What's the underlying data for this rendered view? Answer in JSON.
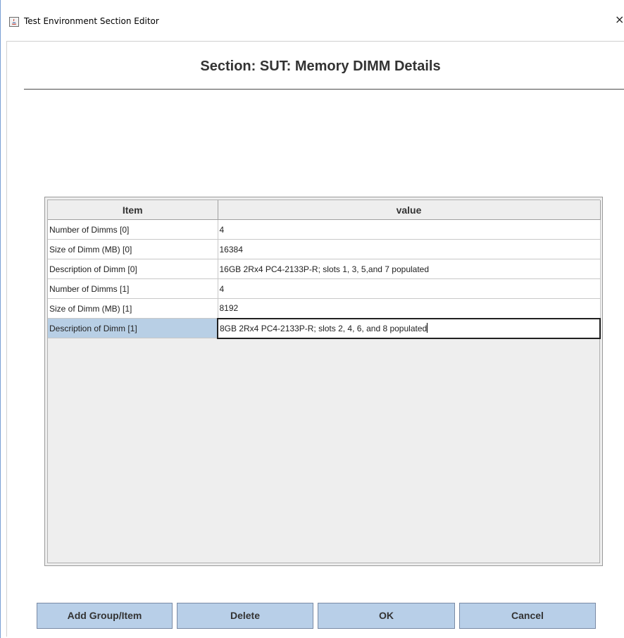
{
  "window": {
    "title": "Test Environment Section Editor",
    "close_glyph": "×",
    "icon": "java-app-icon"
  },
  "header": {
    "title": "Section: SUT: Memory DIMM Details"
  },
  "table": {
    "columns": [
      "Item",
      "value"
    ],
    "rows": [
      {
        "item": "Number of Dimms [0]",
        "value": "4"
      },
      {
        "item": "Size of Dimm (MB) [0]",
        "value": "16384"
      },
      {
        "item": "Description of Dimm [0]",
        "value": "16GB 2Rx4 PC4-2133P-R; slots 1, 3, 5,and 7 populated"
      },
      {
        "item": "Number of Dimms [1]",
        "value": "4"
      },
      {
        "item": "Size of Dimm (MB) [1]",
        "value": "8192"
      },
      {
        "item": "Description of Dimm [1]",
        "value": "8GB 2Rx4 PC4-2133P-R; slots 2, 4, 6, and 8 populated"
      }
    ],
    "selected_row": 5
  },
  "buttons": {
    "add": "Add Group/Item",
    "delete": "Delete",
    "ok": "OK",
    "cancel": "Cancel"
  },
  "colors": {
    "button_bg": "#b8cfe8",
    "selection_bg": "#b8cfe5",
    "header_text": "#333333"
  }
}
